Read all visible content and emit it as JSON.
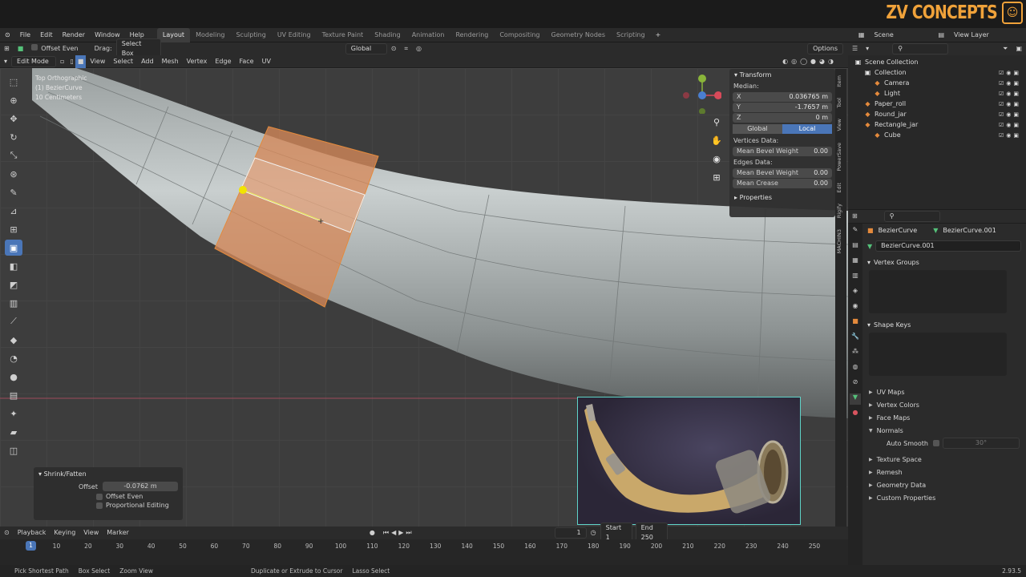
{
  "brand": {
    "logo_text": "ZV CONCEPTS"
  },
  "menubar": {
    "menus": [
      "File",
      "Edit",
      "Render",
      "Window",
      "Help"
    ],
    "workspaces": [
      {
        "label": "Layout",
        "active": true
      },
      {
        "label": "Modeling"
      },
      {
        "label": "Sculpting"
      },
      {
        "label": "UV Editing"
      },
      {
        "label": "Texture Paint"
      },
      {
        "label": "Shading"
      },
      {
        "label": "Animation"
      },
      {
        "label": "Rendering"
      },
      {
        "label": "Compositing"
      },
      {
        "label": "Geometry Nodes"
      },
      {
        "label": "Scripting"
      }
    ],
    "add_tab": "+",
    "scene": "Scene",
    "view_layer": "View Layer"
  },
  "tool_header": {
    "offset_even": "Offset Even",
    "drag_label": "Drag:",
    "drag_value": "Select Box",
    "transform_orientation": "Global",
    "options": "Options"
  },
  "mode_header": {
    "mode": "Edit Mode",
    "menus": [
      "View",
      "Select",
      "Add",
      "Mesh",
      "Vertex",
      "Edge",
      "Face",
      "UV"
    ]
  },
  "viewport": {
    "info_line1": "Top Orthographic",
    "info_line2": "(1) BezierCurve",
    "info_line3": "10 Centimeters"
  },
  "npanel": {
    "transform_title": "Transform",
    "median_label": "Median:",
    "x_label": "X",
    "x_value": "0.036765 m",
    "y_label": "Y",
    "y_value": "-1.7657 m",
    "z_label": "Z",
    "z_value": "0 m",
    "global": "Global",
    "local": "Local",
    "vertices_data": "Vertices Data:",
    "mean_bevel_weight": "Mean Bevel Weight",
    "bevel_v": "0.00",
    "edges_data": "Edges Data:",
    "mean_bevel_weight_e": "Mean Bevel Weight",
    "bevel_e": "0.00",
    "mean_crease": "Mean Crease",
    "crease_v": "0.00",
    "properties": "Properties",
    "tabs": [
      "Item",
      "Tool",
      "View",
      "PowerSave",
      "Edit",
      "Rigify",
      "MACHIN3"
    ]
  },
  "operator_panel": {
    "title": "Shrink/Fatten",
    "offset_label": "Offset",
    "offset_value": "-0.0762 m",
    "offset_even": "Offset Even",
    "proportional": "Proportional Editing"
  },
  "timeline": {
    "menus": [
      "Playback",
      "Keying",
      "View",
      "Marker"
    ],
    "current_frame": "1",
    "start_label": "Start",
    "start": "1",
    "end_label": "End",
    "end": "250",
    "ticks": [
      "10",
      "20",
      "30",
      "40",
      "50",
      "60",
      "70",
      "80",
      "90",
      "100",
      "110",
      "120",
      "130",
      "140",
      "150",
      "160",
      "170",
      "180",
      "190",
      "200",
      "210",
      "220",
      "230",
      "240",
      "250"
    ],
    "playhead": "1"
  },
  "statusbar": {
    "items": [
      "Pick Shortest Path",
      "Box Select",
      "Zoom View",
      "Duplicate or Extrude to Cursor",
      "Lasso Select"
    ],
    "version": "2.93.5"
  },
  "outliner": {
    "rows": [
      {
        "label": "Scene Collection",
        "indent": 0,
        "icon": "▣"
      },
      {
        "label": "Collection",
        "indent": 1,
        "icon": "▣"
      },
      {
        "label": "Camera",
        "indent": 2,
        "icon": "◆"
      },
      {
        "label": "Light",
        "indent": 2,
        "icon": "◆"
      },
      {
        "label": "Paper_roll",
        "indent": 1,
        "icon": "◆"
      },
      {
        "label": "Round_jar",
        "indent": 1,
        "icon": "◆"
      },
      {
        "label": "Rectangle_jar",
        "indent": 1,
        "icon": "◆"
      },
      {
        "label": "Cube",
        "indent": 2,
        "icon": "◆"
      }
    ]
  },
  "properties": {
    "object": "BezierCurve",
    "mesh": "BezierCurve.001",
    "mesh_name": "BezierCurve.001",
    "vertex_groups": "Vertex Groups",
    "shape_keys": "Shape Keys",
    "uv_maps": "UV Maps",
    "vertex_colors": "Vertex Colors",
    "face_maps": "Face Maps",
    "normals": "Normals",
    "auto_smooth": "Auto Smooth",
    "auto_smooth_angle": "30°",
    "texture_space": "Texture Space",
    "remesh": "Remesh",
    "geometry_data": "Geometry Data",
    "custom_properties": "Custom Properties"
  }
}
